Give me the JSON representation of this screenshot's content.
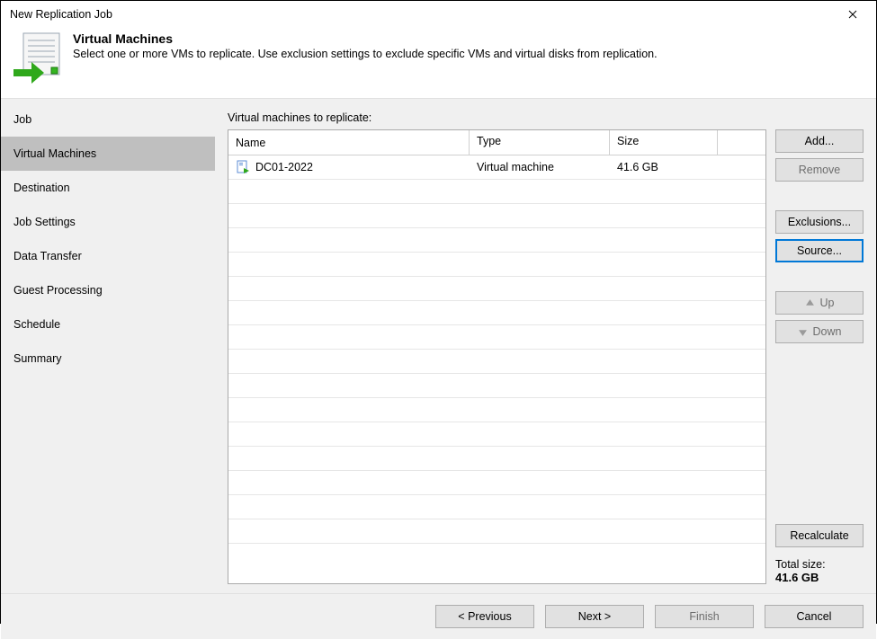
{
  "window": {
    "title": "New Replication Job"
  },
  "banner": {
    "heading": "Virtual Machines",
    "subheading": "Select one or more VMs to replicate. Use exclusion settings to exclude specific VMs and virtual disks from replication."
  },
  "sidebar": {
    "steps": [
      {
        "label": "Job",
        "active": false
      },
      {
        "label": "Virtual Machines",
        "active": true
      },
      {
        "label": "Destination",
        "active": false
      },
      {
        "label": "Job Settings",
        "active": false
      },
      {
        "label": "Data Transfer",
        "active": false
      },
      {
        "label": "Guest Processing",
        "active": false
      },
      {
        "label": "Schedule",
        "active": false
      },
      {
        "label": "Summary",
        "active": false
      }
    ]
  },
  "main": {
    "list_label": "Virtual machines to replicate:",
    "columns": {
      "name": "Name",
      "type": "Type",
      "size": "Size"
    },
    "rows": [
      {
        "name": "DC01-2022",
        "type": "Virtual machine",
        "size": "41.6 GB"
      }
    ],
    "blank_rows": 15,
    "buttons": {
      "add": "Add...",
      "remove": "Remove",
      "exclusions": "Exclusions...",
      "source": "Source...",
      "up": "Up",
      "down": "Down",
      "recalculate": "Recalculate"
    },
    "totals": {
      "label": "Total size:",
      "value": "41.6 GB"
    }
  },
  "footer": {
    "previous": "< Previous",
    "next": "Next >",
    "finish": "Finish",
    "cancel": "Cancel"
  },
  "icons": {
    "close": "✕"
  }
}
